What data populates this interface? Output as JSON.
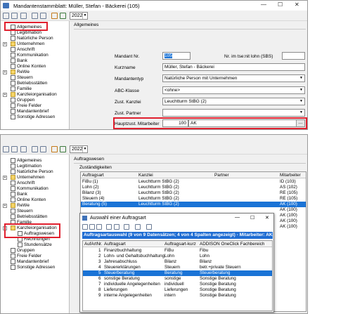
{
  "window1": {
    "title": "Mandantenstammblatt: Müller, Stefan - Bäckerei (105)",
    "year": "2022",
    "section_title": "Allgemeines",
    "tree": [
      "Allgemeines",
      "Legitimation",
      "Natürliche Person",
      "Unternehmen",
      "Anschrift",
      "Kommunikation",
      "Bank",
      "Online Konten",
      "ReWe",
      "Steuern",
      "Betriebsstätten",
      "Familie",
      "Kanzleiorganisation",
      "Gruppen",
      "Freie Felder",
      "Mandantenbrief",
      "Sonstige Adressen"
    ],
    "form": {
      "mandant_nr_label": "Mandant Nr.",
      "mandant_nr": "105",
      "nr_im_lohn_label": "Nr. im tse:nit lohn (SBS)",
      "nr_im_lohn": "",
      "kurzname_label": "Kurzname",
      "kurzname": "Müller, Stefan - Bäckerei",
      "mandantentyp_label": "Mandantentyp",
      "mandantentyp": "Natürliche Person mit Unternehmen",
      "abc_label": "ABC-Klasse",
      "abc": "<ohne>",
      "zust_kanzlei_label": "Zust. Kanzlei",
      "zust_kanzlei": "Leuchtturm StBG (2)",
      "zust_partner_label": "Zust. Partner",
      "zust_partner": "",
      "hauptzust_label": "Hauptzust. Mitarbeiter",
      "hauptzust_nr": "100",
      "hauptzust_kurz": "AK",
      "dots": "..."
    }
  },
  "window2": {
    "year": "2022",
    "section_title": "Auftragswesen",
    "group_title": "Zuständigkeiten",
    "tree": [
      "Allgemeines",
      "Legitimation",
      "Natürliche Person",
      "Unternehmen",
      "Anschrift",
      "Kommunikation",
      "Bank",
      "Online Konten",
      "ReWe",
      "Steuern",
      "Betriebsstätten",
      "Familie",
      "Kanzleiorganisation",
      "Auftragswesen",
      "Rechnungen",
      "Stundensätze",
      "Gruppen",
      "Freie Felder",
      "Mandantenbrief",
      "Sonstige Adressen"
    ],
    "table": {
      "headers": [
        "Auftragsart",
        "Kanzlei",
        "Partner",
        "Mitarbeiter"
      ],
      "rows": [
        [
          "FiBu (1)",
          "Leuchtturm StBG (2)",
          "",
          "ID (103)"
        ],
        [
          "Lohn (2)",
          "Leuchtturm StBG (2)",
          "",
          "AS (102)"
        ],
        [
          "Bilanz (3)",
          "Leuchtturm StBG (2)",
          "",
          "RE (105)"
        ],
        [
          "Steuern (4)",
          "Leuchtturm StBG (2)",
          "",
          "RE (105)"
        ],
        [
          "Beratung (5)",
          "Leuchtturm StBG (2)",
          "",
          "AK (100)"
        ],
        [
          "",
          "",
          "",
          "AK (100)"
        ],
        [
          "",
          "",
          "",
          "AK (100)"
        ],
        [
          "",
          "",
          "",
          "AK (100)"
        ],
        [
          "",
          "",
          "",
          "AK (100)"
        ]
      ]
    }
  },
  "popup": {
    "title": "Auswahl einer Auftragsart",
    "banner": "Auftragsartauswahl (9 von 9 Datensätzen; 4 von 4 Spalten angezeigt) - Mitarbeiter: AK",
    "headers": [
      "AufArtNr.",
      "Auftragsart",
      "Auftragsart-kurz",
      "ADDISON OneClick Fachbereich"
    ],
    "rows": [
      [
        "1",
        "Finanzbuchhaltung",
        "FiBu",
        "Fibu"
      ],
      [
        "2",
        "Lohn- und Gehaltsbuchhaltung",
        "Lohn",
        "Lohn"
      ],
      [
        "3",
        "Jahresabschluss",
        "Bilanz",
        "Bilanz"
      ],
      [
        "4",
        "Steuererklärungen",
        "Steuern",
        "betr.+private Steuern"
      ],
      [
        "5",
        "Steuerberatung",
        "Beratung",
        "Steuerberatung"
      ],
      [
        "6",
        "sonstige Beratung",
        "sonstige",
        "Sonstige Beratung"
      ],
      [
        "7",
        "individuelle Angelegenheiten",
        "individuell",
        "Sonstige Beratung"
      ],
      [
        "8",
        "Lieferungen",
        "Lieferungen",
        "Sonstige Beratung"
      ],
      [
        "9",
        "interne Angelegenheiten",
        "intern",
        "Sonstige Beratung"
      ]
    ],
    "selected_row": 4
  },
  "colors": {
    "selection": "#1a73d6",
    "highlight_box": "#e0202e",
    "banner": "#1f6dd3"
  }
}
